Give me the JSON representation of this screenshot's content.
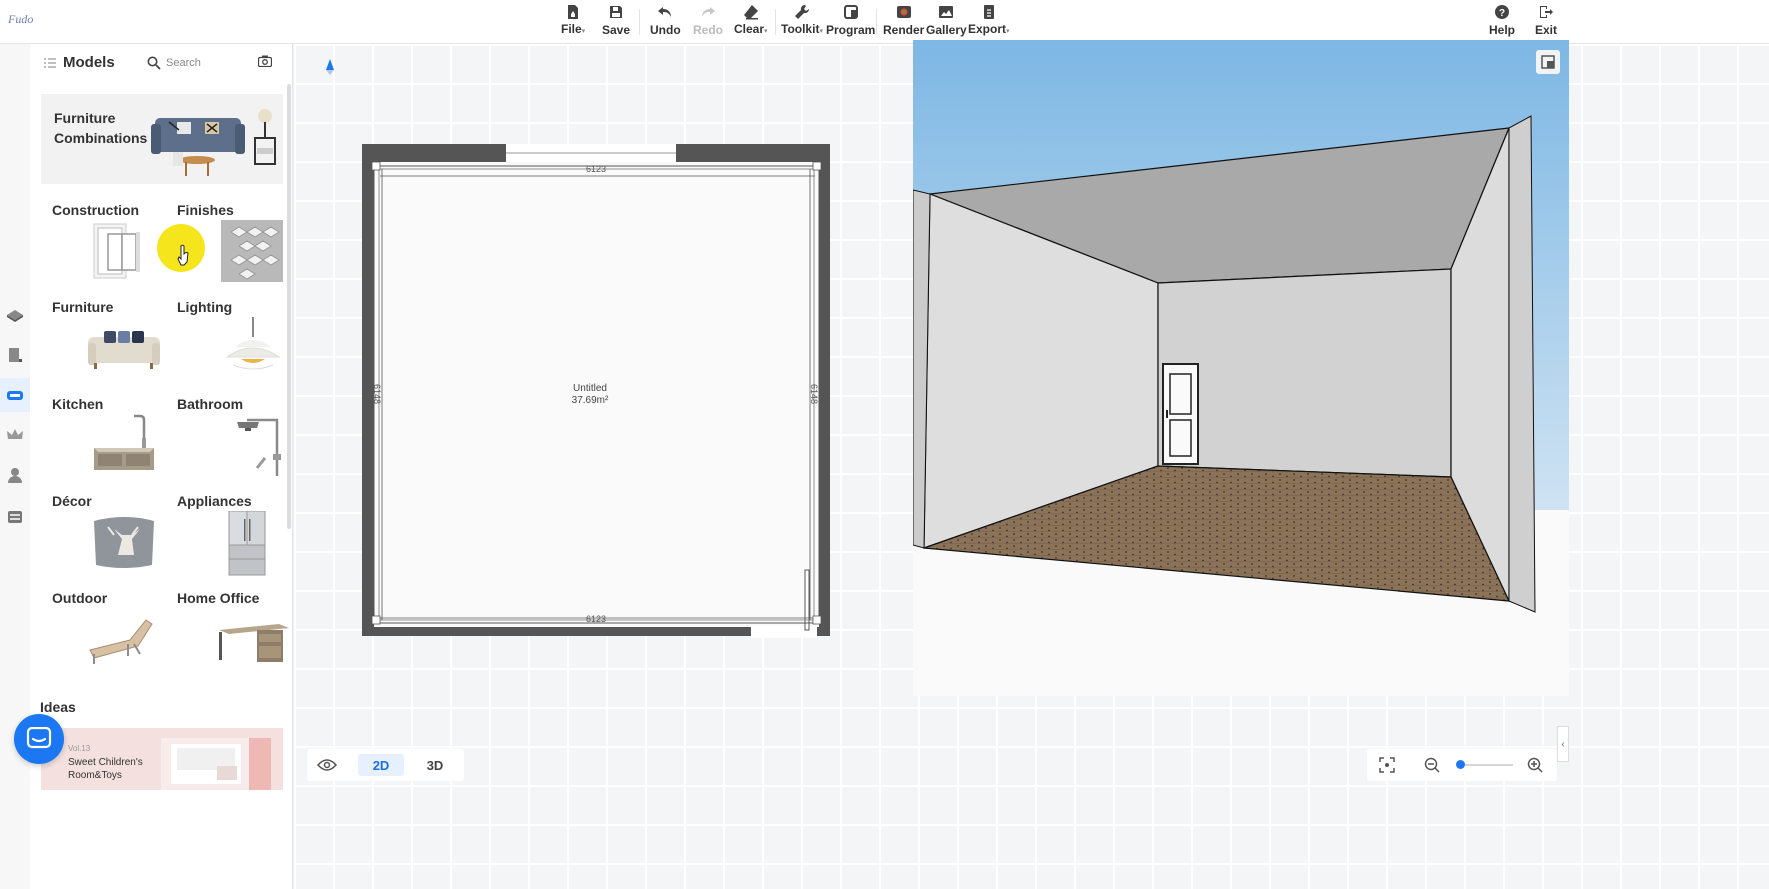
{
  "app": {
    "logo_text": "Fudo"
  },
  "toolbar": {
    "file": "File",
    "save": "Save",
    "undo": "Undo",
    "redo": "Redo",
    "clear": "Clear",
    "toolkit": "Toolkit",
    "program": "Program",
    "render": "Render",
    "gallery": "Gallery",
    "export": "Export",
    "help": "Help",
    "exit": "Exit"
  },
  "panel": {
    "title": "Models",
    "search_placeholder": "Search",
    "combo_title": "Furniture Combinations",
    "categories": [
      {
        "label": "Construction"
      },
      {
        "label": "Finishes"
      },
      {
        "label": "Furniture"
      },
      {
        "label": "Lighting"
      },
      {
        "label": "Kitchen"
      },
      {
        "label": "Bathroom"
      },
      {
        "label": "Décor"
      },
      {
        "label": "Appliances"
      },
      {
        "label": "Outdoor"
      },
      {
        "label": "Home Office"
      }
    ],
    "ideas_title": "Ideas",
    "ideas_card": {
      "vol": "Vol.13",
      "title": "Sweet Children's Room&Toys"
    }
  },
  "plan": {
    "room_name": "Untitled",
    "area": "37.69m²",
    "dim_top": "6123",
    "dim_bottom": "6123",
    "dim_left": "6148",
    "dim_right": "6148"
  },
  "view": {
    "btn_2d": "2D",
    "btn_3d": "3D",
    "active": "2D"
  },
  "zoom": {
    "level": 0.05
  },
  "colors": {
    "accent": "#1b78f2",
    "wall": "#545454",
    "sky": "#8fc3e8",
    "floor": "#8b7359"
  }
}
